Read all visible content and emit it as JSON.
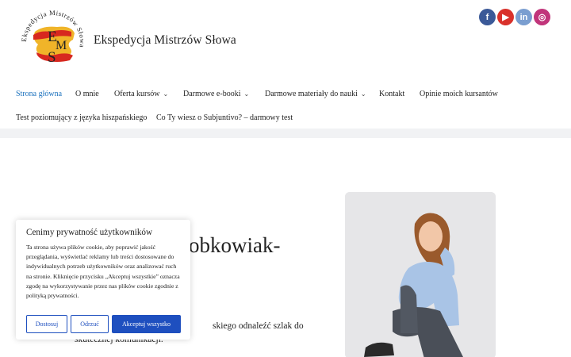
{
  "site": {
    "title": "Ekspedycja Mistrzów Słowa",
    "logo_ring_text": "Ekspedycja Mistrzów Słowa",
    "logo_monogram": "EMS"
  },
  "social": [
    {
      "name": "facebook-icon",
      "glyph": "f"
    },
    {
      "name": "youtube-icon",
      "glyph": "▶"
    },
    {
      "name": "linkedin-icon",
      "glyph": "in"
    },
    {
      "name": "instagram-icon",
      "glyph": "◎"
    }
  ],
  "nav": {
    "items": [
      {
        "label": "Strona główna",
        "active": true,
        "dropdown": false
      },
      {
        "label": "O mnie",
        "dropdown": false
      },
      {
        "label": "Oferta kursów",
        "dropdown": true
      },
      {
        "label": "Darmowe e-booki",
        "dropdown": true
      },
      {
        "label": "Darmowe materiały do nauki",
        "dropdown": true
      },
      {
        "label": "Kontakt",
        "dropdown": false
      },
      {
        "label": "Opinie moich kursantów",
        "dropdown": false
      },
      {
        "label": "Test poziomujący z języka hiszpańskiego",
        "dropdown": false
      },
      {
        "label": "Co Ty wiesz o Subjuntivo? – darmowy test",
        "dropdown": false
      }
    ],
    "chevron": "⌄"
  },
  "main": {
    "heading_fragment": "obkowiak-",
    "body_fragment_1": "skiego odnaleźć szlak do",
    "body_fragment_2": "skutecznej komunikacji."
  },
  "cookie": {
    "title": "Cenimy prywatność użytkowników",
    "text": "Ta strona używa plików cookie, aby poprawić jakość przeglądania, wyświetlać reklamy lub treści dostosowane do indywidualnych potrzeb użytkowników oraz analizować ruch na stronie. Kliknięcie przycisku „Akceptuj wszystkie” oznacza zgodę na wykorzystywanie przez nas plików cookie zgodnie z polityką prywatności.",
    "btn_customize": "Dostosuj",
    "btn_reject": "Odrzuć",
    "btn_accept": "Akceptuj wszystko"
  },
  "colors": {
    "accent": "#1e4fbf",
    "nav_active": "#1e73be",
    "band": "#f1f2f4"
  }
}
